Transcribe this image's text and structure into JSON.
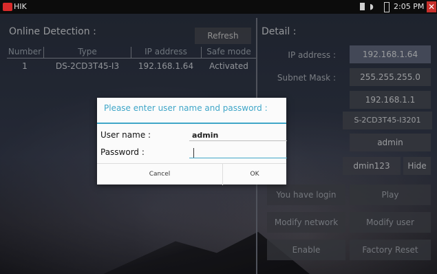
{
  "statusbar": {
    "app_title": "HIK",
    "time": "2:05 PM"
  },
  "left": {
    "title": "Online Detection :",
    "refresh_label": "Refresh",
    "columns": [
      "Number",
      "Type",
      "IP address",
      "Safe mode"
    ],
    "rows": [
      {
        "number": "1",
        "type": "DS-2CD3T45-I3",
        "ip": "192.168.1.64",
        "safe_mode": "Activated"
      }
    ]
  },
  "detail": {
    "title": "Detail :",
    "ip_label": "IP address :",
    "ip_value": "192.168.1.64",
    "mask_label": "Subnet Mask :",
    "mask_value": "255.255.255.0",
    "gateway_value": "192.168.1.1",
    "model_value": "S-2CD3T45-I3201",
    "user_value": "admin",
    "password_value": "dmin123",
    "hide_label": "Hide",
    "login_status": "You have login",
    "play_label": "Play",
    "modify_network_label": "Modify network",
    "modify_user_label": "Modify user",
    "enable_label": "Enable",
    "factory_reset_label": "Factory Reset"
  },
  "dialog": {
    "title": "Please enter user name and password :",
    "username_label": "User name :",
    "username_value": "admin",
    "password_label": "Password :",
    "password_value": "",
    "cancel_label": "Cancel",
    "ok_label": "OK"
  },
  "colors": {
    "accent": "#3fa6c8",
    "close": "#c9302c"
  }
}
